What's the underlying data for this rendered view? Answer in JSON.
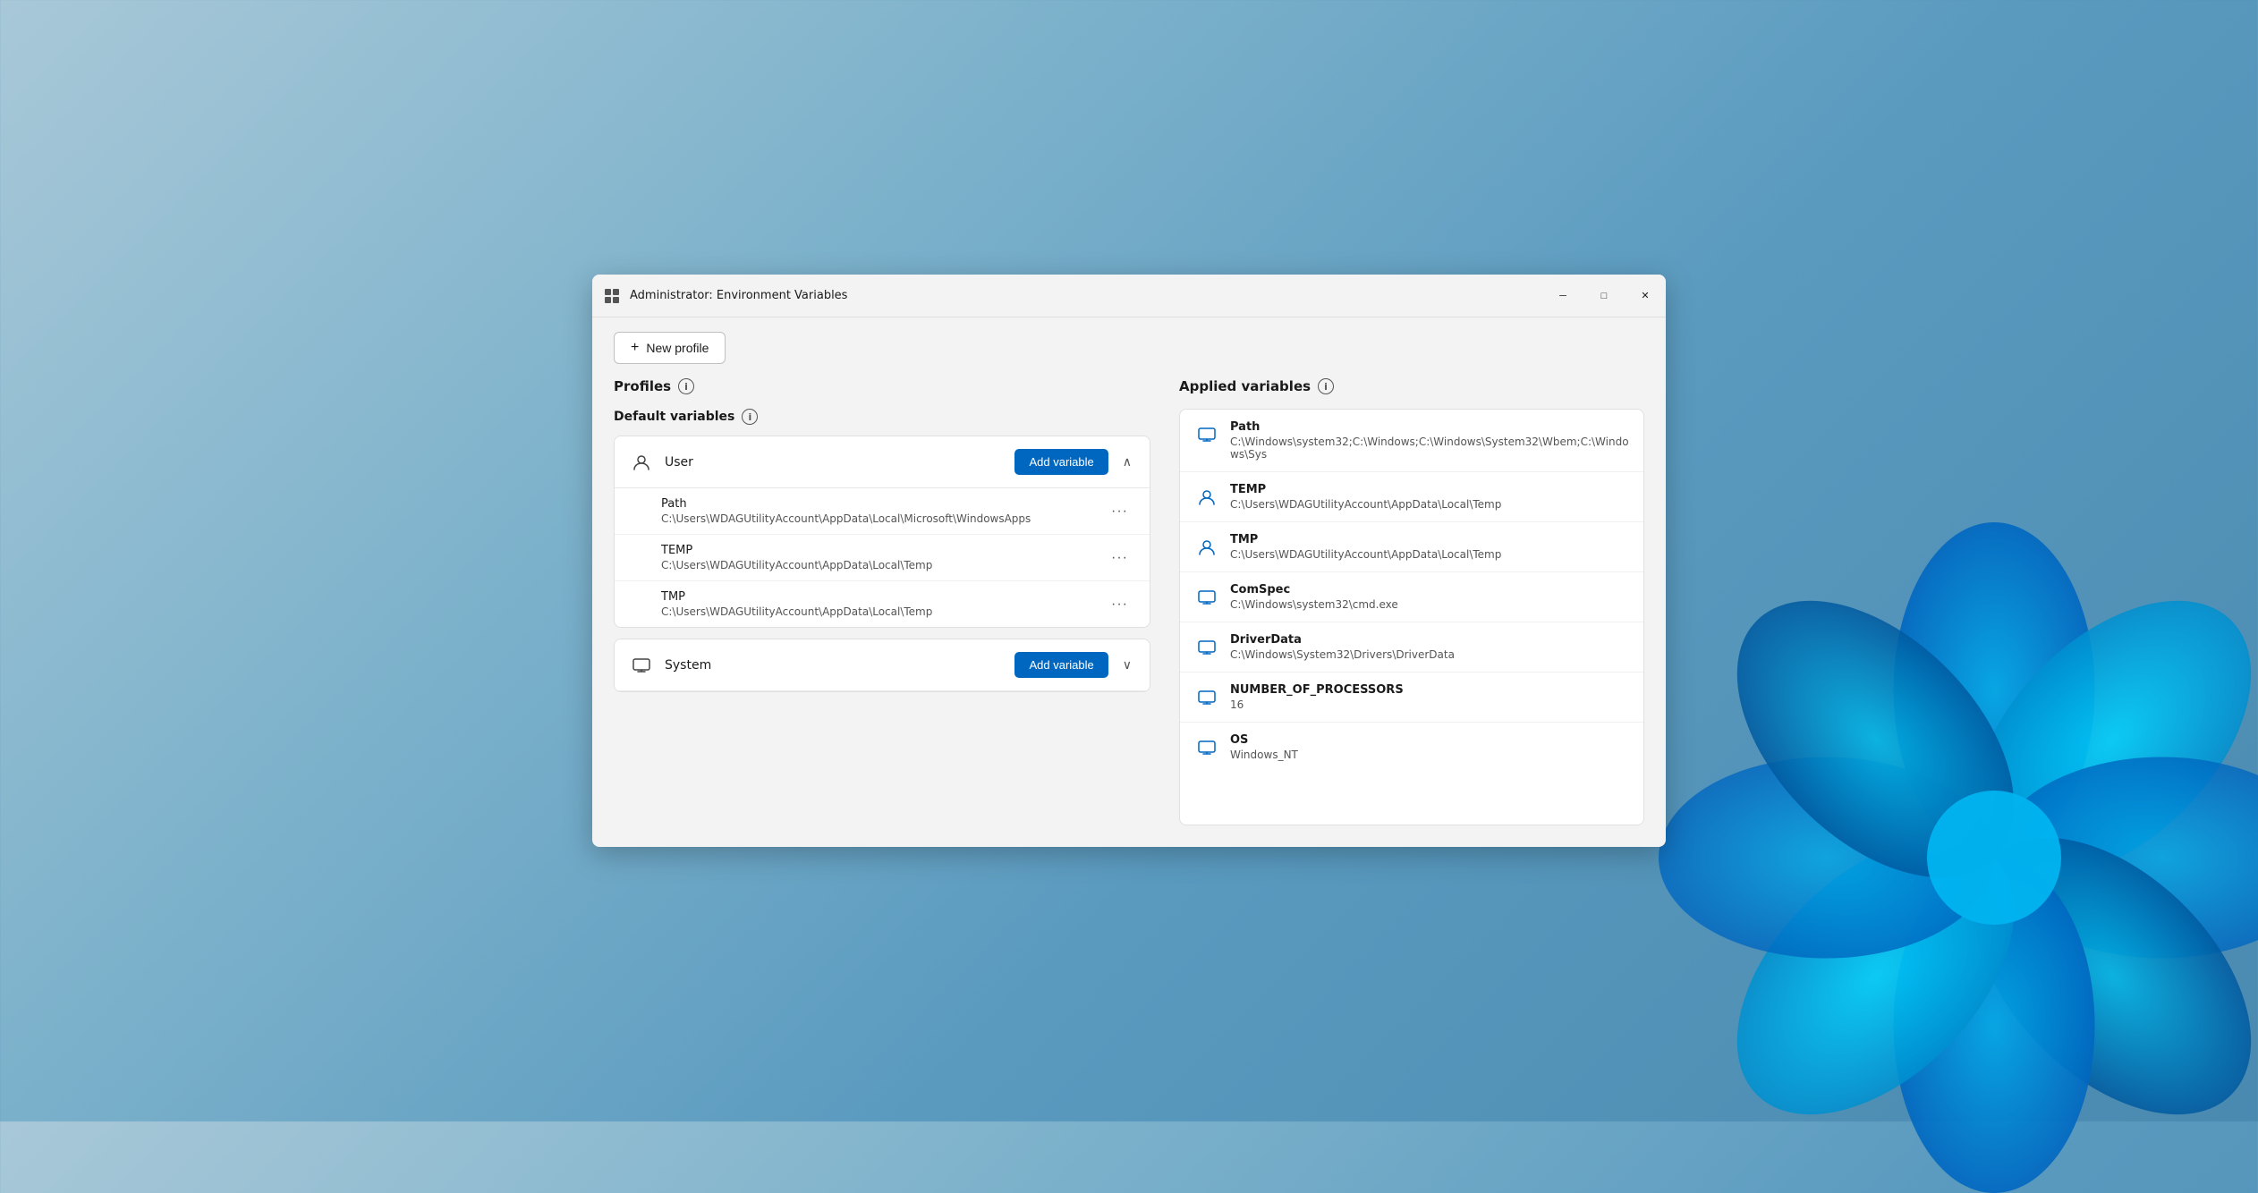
{
  "window": {
    "title": "Administrator: Environment Variables",
    "icon": "⚙"
  },
  "titlebar_controls": {
    "minimize": "─",
    "maximize": "□",
    "close": "✕"
  },
  "toolbar": {
    "new_profile_label": "New profile",
    "new_profile_plus": "+"
  },
  "left_panel": {
    "profiles_header": "Profiles",
    "default_variables_header": "Default variables",
    "user_group": {
      "label": "User",
      "add_variable_btn": "Add variable",
      "chevron": "∧",
      "variables": [
        {
          "name": "Path",
          "value": "C:\\Users\\WDAGUtilityAccount\\AppData\\Local\\Microsoft\\WindowsApps"
        },
        {
          "name": "TEMP",
          "value": "C:\\Users\\WDAGUtilityAccount\\AppData\\Local\\Temp"
        },
        {
          "name": "TMP",
          "value": "C:\\Users\\WDAGUtilityAccount\\AppData\\Local\\Temp"
        }
      ]
    },
    "system_group": {
      "label": "System",
      "add_variable_btn": "Add variable",
      "chevron": "∨"
    }
  },
  "right_panel": {
    "applied_variables_header": "Applied variables",
    "variables": [
      {
        "name": "Path",
        "value": "C:\\Windows\\system32;C:\\Windows;C:\\Windows\\System32\\Wbem;C:\\Windows\\Sys",
        "icon_type": "display"
      },
      {
        "name": "TEMP",
        "value": "C:\\Users\\WDAGUtilityAccount\\AppData\\Local\\Temp",
        "icon_type": "user"
      },
      {
        "name": "TMP",
        "value": "C:\\Users\\WDAGUtilityAccount\\AppData\\Local\\Temp",
        "icon_type": "user"
      },
      {
        "name": "ComSpec",
        "value": "C:\\Windows\\system32\\cmd.exe",
        "icon_type": "display"
      },
      {
        "name": "DriverData",
        "value": "C:\\Windows\\System32\\Drivers\\DriverData",
        "icon_type": "display"
      },
      {
        "name": "NUMBER_OF_PROCESSORS",
        "value": "16",
        "icon_type": "display"
      },
      {
        "name": "OS",
        "value": "Windows_NT",
        "icon_type": "display"
      }
    ]
  },
  "colors": {
    "accent": "#0067c0",
    "border": "#e0e0e0",
    "text_primary": "#1a1a1a",
    "text_secondary": "#555555"
  }
}
